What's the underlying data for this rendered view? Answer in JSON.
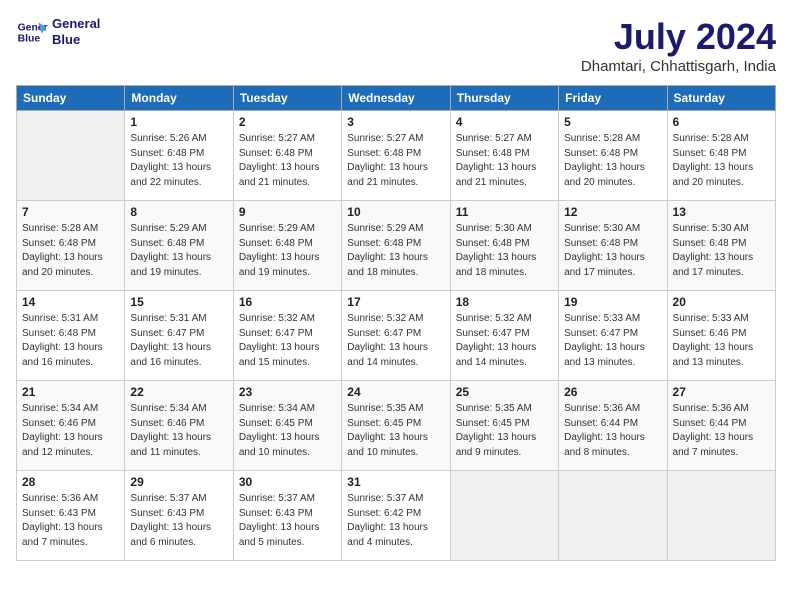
{
  "header": {
    "logo_line1": "General",
    "logo_line2": "Blue",
    "month": "July 2024",
    "location": "Dhamtari, Chhattisgarh, India"
  },
  "days_of_week": [
    "Sunday",
    "Monday",
    "Tuesday",
    "Wednesday",
    "Thursday",
    "Friday",
    "Saturday"
  ],
  "weeks": [
    [
      {
        "day": "",
        "info": ""
      },
      {
        "day": "1",
        "info": "Sunrise: 5:26 AM\nSunset: 6:48 PM\nDaylight: 13 hours\nand 22 minutes."
      },
      {
        "day": "2",
        "info": "Sunrise: 5:27 AM\nSunset: 6:48 PM\nDaylight: 13 hours\nand 21 minutes."
      },
      {
        "day": "3",
        "info": "Sunrise: 5:27 AM\nSunset: 6:48 PM\nDaylight: 13 hours\nand 21 minutes."
      },
      {
        "day": "4",
        "info": "Sunrise: 5:27 AM\nSunset: 6:48 PM\nDaylight: 13 hours\nand 21 minutes."
      },
      {
        "day": "5",
        "info": "Sunrise: 5:28 AM\nSunset: 6:48 PM\nDaylight: 13 hours\nand 20 minutes."
      },
      {
        "day": "6",
        "info": "Sunrise: 5:28 AM\nSunset: 6:48 PM\nDaylight: 13 hours\nand 20 minutes."
      }
    ],
    [
      {
        "day": "7",
        "info": "Sunrise: 5:28 AM\nSunset: 6:48 PM\nDaylight: 13 hours\nand 20 minutes."
      },
      {
        "day": "8",
        "info": "Sunrise: 5:29 AM\nSunset: 6:48 PM\nDaylight: 13 hours\nand 19 minutes."
      },
      {
        "day": "9",
        "info": "Sunrise: 5:29 AM\nSunset: 6:48 PM\nDaylight: 13 hours\nand 19 minutes."
      },
      {
        "day": "10",
        "info": "Sunrise: 5:29 AM\nSunset: 6:48 PM\nDaylight: 13 hours\nand 18 minutes."
      },
      {
        "day": "11",
        "info": "Sunrise: 5:30 AM\nSunset: 6:48 PM\nDaylight: 13 hours\nand 18 minutes."
      },
      {
        "day": "12",
        "info": "Sunrise: 5:30 AM\nSunset: 6:48 PM\nDaylight: 13 hours\nand 17 minutes."
      },
      {
        "day": "13",
        "info": "Sunrise: 5:30 AM\nSunset: 6:48 PM\nDaylight: 13 hours\nand 17 minutes."
      }
    ],
    [
      {
        "day": "14",
        "info": "Sunrise: 5:31 AM\nSunset: 6:48 PM\nDaylight: 13 hours\nand 16 minutes."
      },
      {
        "day": "15",
        "info": "Sunrise: 5:31 AM\nSunset: 6:47 PM\nDaylight: 13 hours\nand 16 minutes."
      },
      {
        "day": "16",
        "info": "Sunrise: 5:32 AM\nSunset: 6:47 PM\nDaylight: 13 hours\nand 15 minutes."
      },
      {
        "day": "17",
        "info": "Sunrise: 5:32 AM\nSunset: 6:47 PM\nDaylight: 13 hours\nand 14 minutes."
      },
      {
        "day": "18",
        "info": "Sunrise: 5:32 AM\nSunset: 6:47 PM\nDaylight: 13 hours\nand 14 minutes."
      },
      {
        "day": "19",
        "info": "Sunrise: 5:33 AM\nSunset: 6:47 PM\nDaylight: 13 hours\nand 13 minutes."
      },
      {
        "day": "20",
        "info": "Sunrise: 5:33 AM\nSunset: 6:46 PM\nDaylight: 13 hours\nand 13 minutes."
      }
    ],
    [
      {
        "day": "21",
        "info": "Sunrise: 5:34 AM\nSunset: 6:46 PM\nDaylight: 13 hours\nand 12 minutes."
      },
      {
        "day": "22",
        "info": "Sunrise: 5:34 AM\nSunset: 6:46 PM\nDaylight: 13 hours\nand 11 minutes."
      },
      {
        "day": "23",
        "info": "Sunrise: 5:34 AM\nSunset: 6:45 PM\nDaylight: 13 hours\nand 10 minutes."
      },
      {
        "day": "24",
        "info": "Sunrise: 5:35 AM\nSunset: 6:45 PM\nDaylight: 13 hours\nand 10 minutes."
      },
      {
        "day": "25",
        "info": "Sunrise: 5:35 AM\nSunset: 6:45 PM\nDaylight: 13 hours\nand 9 minutes."
      },
      {
        "day": "26",
        "info": "Sunrise: 5:36 AM\nSunset: 6:44 PM\nDaylight: 13 hours\nand 8 minutes."
      },
      {
        "day": "27",
        "info": "Sunrise: 5:36 AM\nSunset: 6:44 PM\nDaylight: 13 hours\nand 7 minutes."
      }
    ],
    [
      {
        "day": "28",
        "info": "Sunrise: 5:36 AM\nSunset: 6:43 PM\nDaylight: 13 hours\nand 7 minutes."
      },
      {
        "day": "29",
        "info": "Sunrise: 5:37 AM\nSunset: 6:43 PM\nDaylight: 13 hours\nand 6 minutes."
      },
      {
        "day": "30",
        "info": "Sunrise: 5:37 AM\nSunset: 6:43 PM\nDaylight: 13 hours\nand 5 minutes."
      },
      {
        "day": "31",
        "info": "Sunrise: 5:37 AM\nSunset: 6:42 PM\nDaylight: 13 hours\nand 4 minutes."
      },
      {
        "day": "",
        "info": ""
      },
      {
        "day": "",
        "info": ""
      },
      {
        "day": "",
        "info": ""
      }
    ]
  ]
}
